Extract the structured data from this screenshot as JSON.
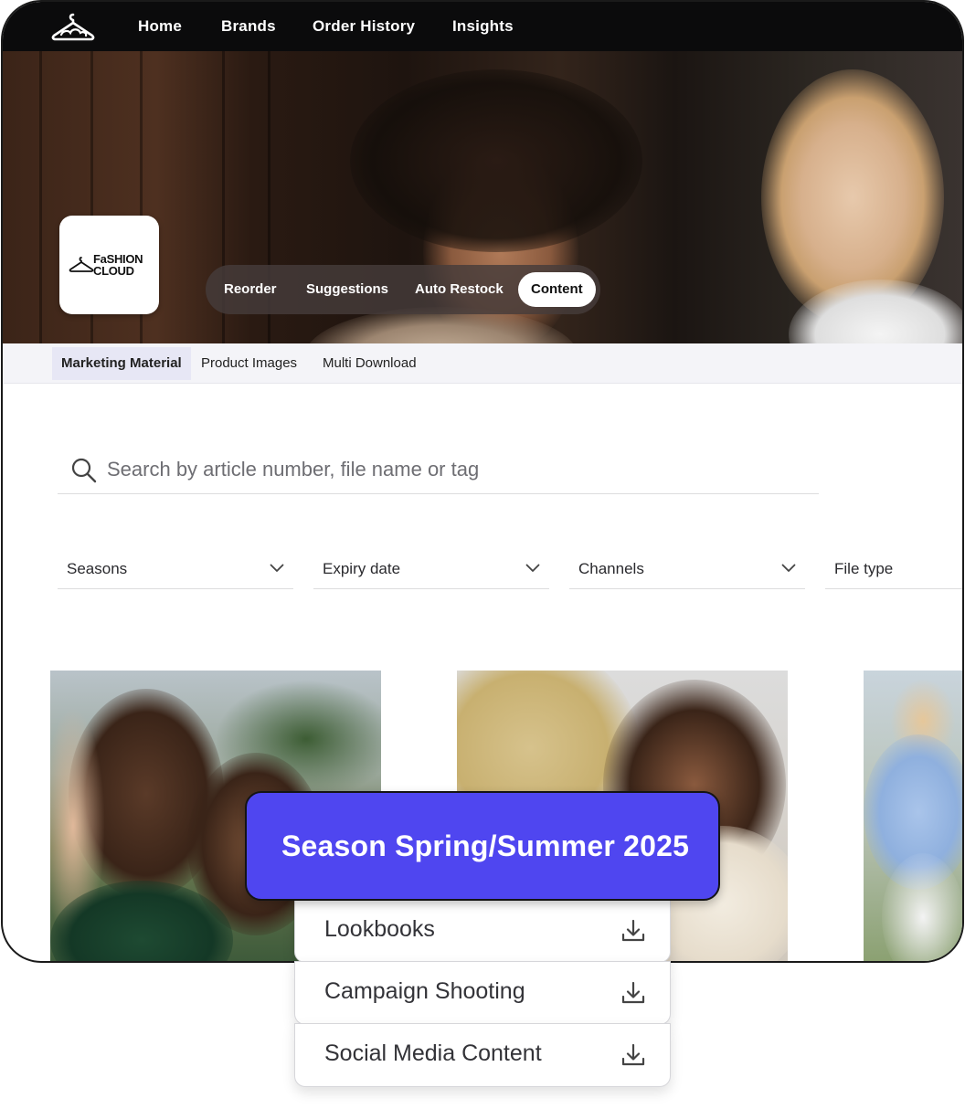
{
  "topnav": {
    "logo_icon": "hanger-icon",
    "items": [
      {
        "label": "Home"
      },
      {
        "label": "Brands"
      },
      {
        "label": "Order History"
      },
      {
        "label": "Insights"
      }
    ]
  },
  "brand": {
    "logo_line1": "FaSHION",
    "logo_line2": "CLOUD"
  },
  "pill_nav": {
    "items": [
      {
        "label": "Reorder",
        "active": false
      },
      {
        "label": "Suggestions",
        "active": false
      },
      {
        "label": "Auto Restock",
        "active": false
      },
      {
        "label": "Content",
        "active": true
      }
    ]
  },
  "subtabs": {
    "items": [
      {
        "label": "Marketing Material",
        "active": true
      },
      {
        "label": "Product Images",
        "active": false
      },
      {
        "label": "Multi Download",
        "active": false
      }
    ]
  },
  "search": {
    "icon": "search-icon",
    "placeholder": "Search by article number, file name or tag"
  },
  "filters": [
    {
      "label": "Seasons",
      "icon": "chevron-down-icon"
    },
    {
      "label": "Expiry date",
      "icon": "chevron-down-icon"
    },
    {
      "label": "Channels",
      "icon": "chevron-down-icon"
    },
    {
      "label": "File type"
    }
  ],
  "overlay": {
    "season_label": "Season Spring/Summer 2025",
    "downloads": [
      {
        "label": "Lookbooks",
        "icon": "download-icon"
      },
      {
        "label": "Campaign Shooting",
        "icon": "download-icon"
      },
      {
        "label": "Social Media Content",
        "icon": "download-icon"
      }
    ]
  },
  "colors": {
    "accent": "#4f46f0",
    "nav_bg": "#0b0b0c",
    "active_subtab_bg": "#e7e7f5"
  }
}
